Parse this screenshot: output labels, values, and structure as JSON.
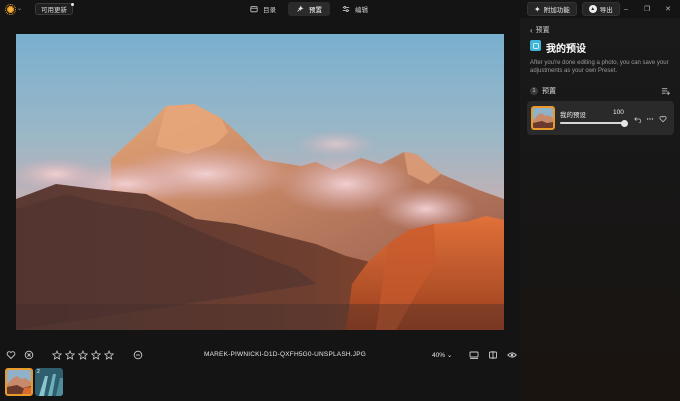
{
  "topbar": {
    "update_label": "可用更新",
    "tabs": [
      {
        "label": "目录",
        "icon": "catalog-icon"
      },
      {
        "label": "预置",
        "icon": "presets-icon",
        "active": true
      },
      {
        "label": "编辑",
        "icon": "edit-sliders-icon"
      }
    ],
    "add_ons_label": "附加功能",
    "export_label": "导出",
    "window": {
      "minimize": "–",
      "restore": "❐",
      "close": "✕"
    }
  },
  "viewer": {
    "filename": "MAREK-PIWNICKI-D1D-QXFH5G0-UNSPLASH.JPG",
    "zoom": "40%",
    "rating_stars": 5
  },
  "filmstrip": [
    {
      "name": "thumb-sunset-mountains",
      "selected": true
    },
    {
      "name": "thumb-blue-building",
      "badge": "2"
    }
  ],
  "panel": {
    "back_label": "预置",
    "title": "我的预设",
    "description": "After you're done editing a photo, you can save your adjustments as your own Preset.",
    "section_number": "1",
    "section_label": "预置",
    "preset": {
      "name": "我的预设",
      "amount": 100,
      "max": 100
    }
  },
  "colors": {
    "accent": "#e89a2a",
    "panel_bg": "#1a1a1a",
    "app_bg": "#141414",
    "preset_icon": "#3fb6d8"
  }
}
